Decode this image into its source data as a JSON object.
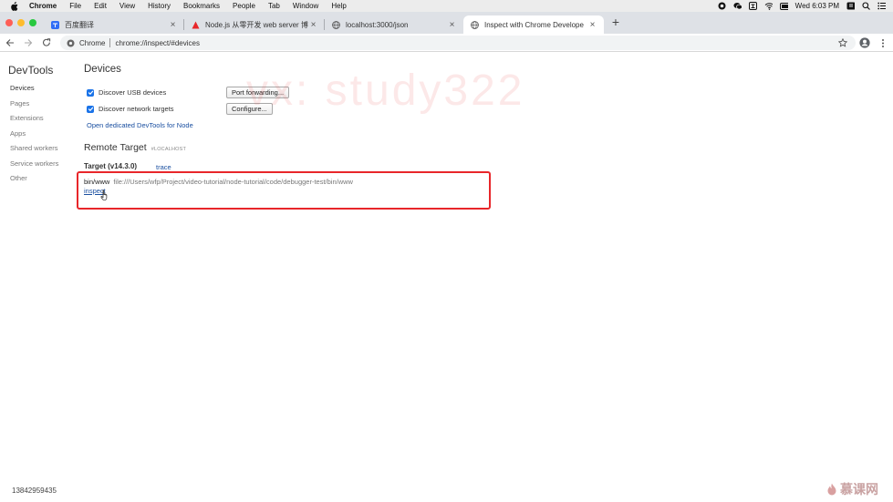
{
  "menubar": {
    "items": [
      "Chrome",
      "File",
      "Edit",
      "View",
      "History",
      "Bookmarks",
      "People",
      "Tab",
      "Window",
      "Help"
    ],
    "clock": "Wed 6:03 PM"
  },
  "tabs": [
    {
      "title": "百度翻译",
      "active": false
    },
    {
      "title": "Node.js 从零开发 web server 博",
      "active": false
    },
    {
      "title": "localhost:3000/json",
      "active": false
    },
    {
      "title": "Inspect with Chrome Develope",
      "active": true
    }
  ],
  "toolbar": {
    "origin": "Chrome",
    "url": "chrome://inspect/#devices"
  },
  "sidebar": {
    "title": "DevTools",
    "items": [
      "Devices",
      "Pages",
      "Extensions",
      "Apps",
      "Shared workers",
      "Service workers",
      "Other"
    ]
  },
  "devices": {
    "title": "Devices",
    "discover_usb": "Discover USB devices",
    "port_forwarding": "Port forwarding...",
    "discover_network": "Discover network targets",
    "configure": "Configure...",
    "open_node": "Open dedicated DevTools for Node"
  },
  "remote": {
    "title": "Remote Target",
    "tag": "#LOCALHOST",
    "target": "Target (v14.3.0)",
    "trace": "trace",
    "entry_name": "bin/www",
    "entry_path": "file:///Users/wfp/Project/video-tutorial/node-tutorial/code/debugger-test/bin/www",
    "inspect": "inspect"
  },
  "overlay": {
    "watermark": "vx: study322",
    "student_id": "13842959435",
    "brand": "慕课网"
  },
  "colors": {
    "highlight": "#e8262a",
    "link": "#1a4fa0",
    "checkbox": "#1a73e8"
  }
}
